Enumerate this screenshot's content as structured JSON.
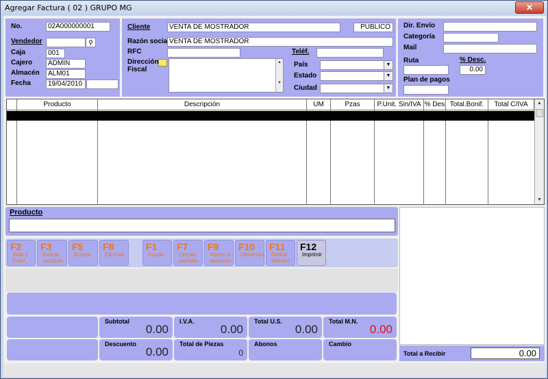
{
  "window": {
    "title": "Agregar Factura ( 02 ) GRUPO MG",
    "close": "✕"
  },
  "header": {
    "no_label": "No.",
    "no_value": "02A000000001",
    "vendedor_label": "Vendedor",
    "vendedor_value": "",
    "caja_label": "Caja",
    "caja_value": "001",
    "cajero_label": "Cajero",
    "cajero_value": "ADMIN",
    "almacen_label": "Almacén",
    "almacen_value": "ALM01",
    "fecha_label": "Fecha",
    "fecha_value": "19/04/2010",
    "fecha_extra": "",
    "cliente_label": "Cliente",
    "cliente_value": "VENTA DE MOSTRADOR",
    "cliente_tipo": "PUBLICO",
    "razon_label": "Razón social",
    "razon_value": "VENTA DE MOSTRADOR",
    "rfc_label": "RFC",
    "rfc_value": "",
    "telef_label": "Teléf.",
    "telef_value": "",
    "direccion_label": "Dirección Fiscal",
    "direccion_value": "",
    "pais_label": "País",
    "estado_label": "Estado",
    "ciudad_label": "Ciudad",
    "direnvio_label": "Dir. Envío",
    "direnvio_value": "",
    "categoria_label": "Categoría",
    "categoria_value": "",
    "mail_label": "Mail",
    "mail_value": "",
    "ruta_label": "Ruta",
    "ruta_value": "",
    "desc_label": "% Desc.",
    "desc_value": "0.00",
    "plan_label": "Plan de pagos",
    "plan_value": ""
  },
  "grid": {
    "columns": [
      "Producto",
      "Descripción",
      "UM",
      "Pzas",
      "P.Unit. Sin/IVA",
      "% Des",
      "Total.Bonif.",
      "Total C/IVA"
    ]
  },
  "producto": {
    "label": "Producto",
    "value": ""
  },
  "fkeys": [
    {
      "key": "F2",
      "desc": "Talla y Color"
    },
    {
      "key": "F3",
      "desc": "Buscar sustituto"
    },
    {
      "key": "F5",
      "desc": "Buscar"
    },
    {
      "key": "F8",
      "desc": "Eliminar"
    },
    {
      "key": "F1",
      "desc": "Ayuda"
    },
    {
      "key": "F7",
      "desc": "Limpiar pantalla"
    },
    {
      "key": "F9",
      "desc": "Abono a apartado"
    },
    {
      "key": "F10",
      "desc": "Observac."
    },
    {
      "key": "F11",
      "desc": "Retirar efectivo"
    },
    {
      "key": "F12",
      "desc": "Imprimir"
    }
  ],
  "totals": {
    "subtotal_label": "Subtotal",
    "subtotal_value": "0.00",
    "iva_label": "I.V.A.",
    "iva_value": "0.00",
    "total_us_label": "Total U.S.",
    "total_us_value": "0.00",
    "total_mn_label": "Total M.N.",
    "total_mn_value": "0.00",
    "descuento_label": "Descuento",
    "descuento_value": "0.00",
    "piezas_label": "Total de Piezas",
    "piezas_value": "0",
    "abonos_label": "Abonos",
    "cambio_label": "Cambio",
    "recibir_label": "Total a Recibir",
    "recibir_value": "0.00"
  },
  "colors": {
    "panel": "#aaaaf0",
    "fkey_text": "#f07810",
    "total_mn": "#e01010"
  }
}
